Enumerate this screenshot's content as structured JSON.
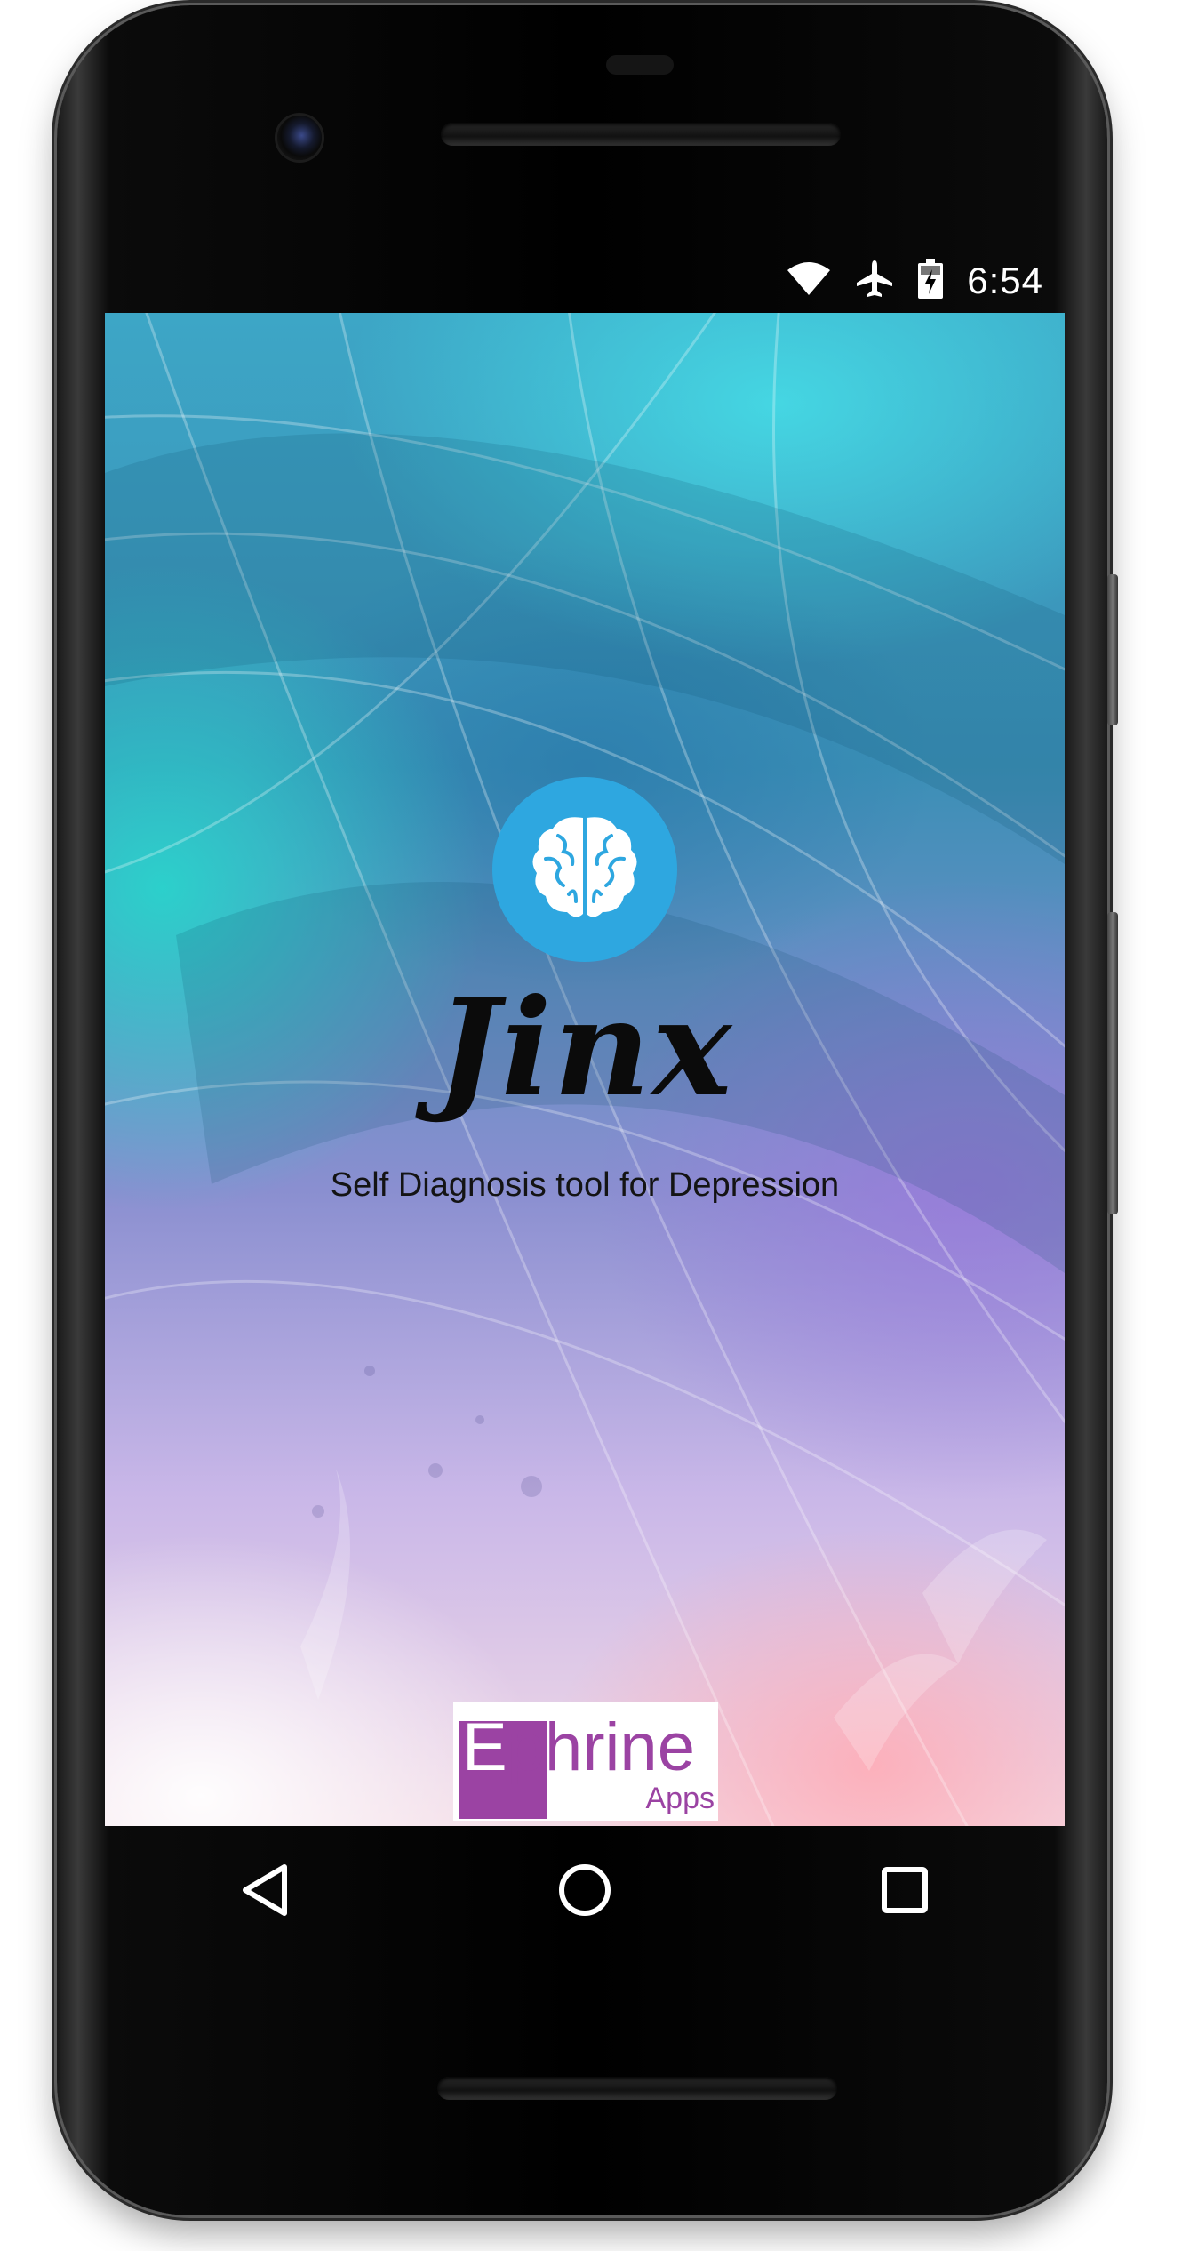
{
  "status_bar": {
    "time": "6:54",
    "icons": [
      "wifi-icon",
      "airplane-mode-icon",
      "battery-charging-icon"
    ]
  },
  "splash": {
    "app_name": "Jinx",
    "tagline": "Self Diagnosis tool for Depression",
    "logo_icon": "brain-icon",
    "logo_color": "#2ea7e0"
  },
  "brand": {
    "word_first": "E",
    "word_rest": "phrine",
    "sub": "Apps",
    "color": "#9b43a3"
  },
  "nav_bar": {
    "buttons": [
      "back-icon",
      "home-icon",
      "recents-icon"
    ]
  }
}
